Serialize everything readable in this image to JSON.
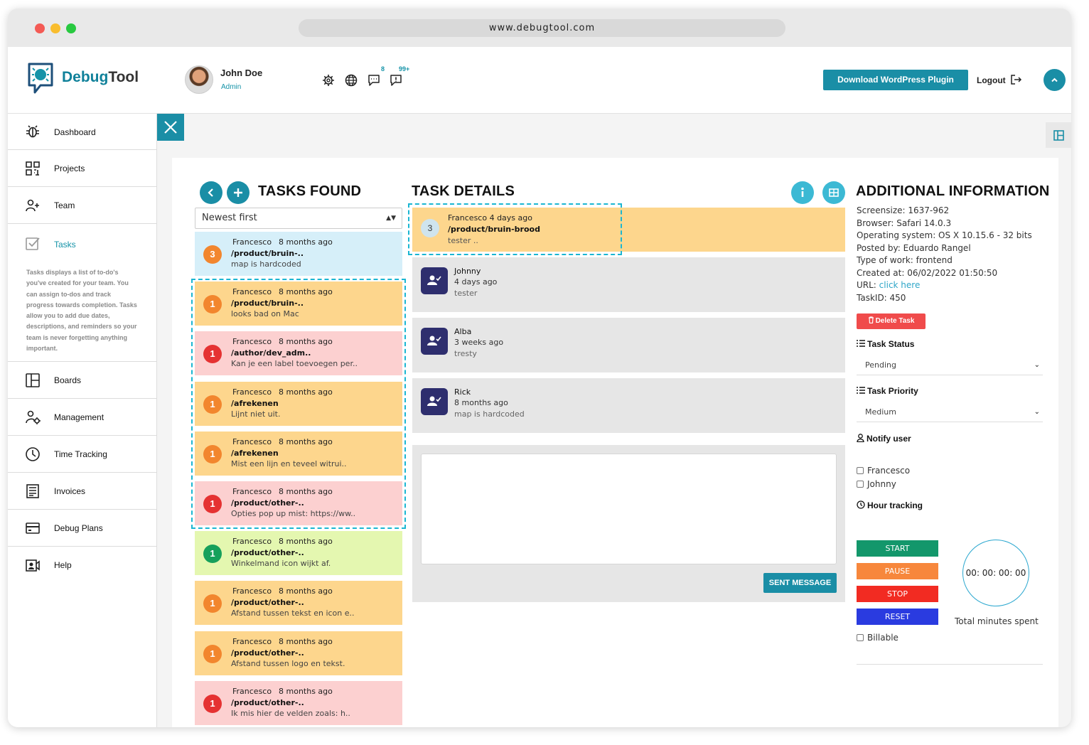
{
  "browser": {
    "url": "www.debugtool.com",
    "traffic_lights": [
      "#f45b55",
      "#f9bd2e",
      "#28c940"
    ]
  },
  "header": {
    "logo_text_1": "Debug",
    "logo_text_2": "Tool",
    "user_name": "John Doe",
    "user_role": "Admin",
    "chat_badge": "8",
    "notify_badge": "99+",
    "download_button": "Download WordPress Plugin",
    "logout": "Logout"
  },
  "sidebar": {
    "items": [
      {
        "label": "Dashboard",
        "icon": "bug-icon"
      },
      {
        "label": "Projects",
        "icon": "grid-icon"
      },
      {
        "label": "Team",
        "icon": "team-icon"
      },
      {
        "label": "Tasks",
        "icon": "checkbox-icon"
      },
      {
        "label": "Boards",
        "icon": "board-icon"
      },
      {
        "label": "Management",
        "icon": "management-icon"
      },
      {
        "label": "Time Tracking",
        "icon": "clock-icon"
      },
      {
        "label": "Invoices",
        "icon": "invoice-icon"
      },
      {
        "label": "Debug Plans",
        "icon": "card-icon"
      },
      {
        "label": "Help",
        "icon": "help-icon"
      }
    ],
    "tasks_description": "Tasks displays a list of to-do's you've created for your team. You can assign to-dos and track progress towards completion. Tasks allow you to add due dates, descriptions, and reminders so your team is never forgetting anything important."
  },
  "tasks": {
    "title": "TASKS FOUND",
    "sort_value": "Newest first",
    "items": [
      {
        "count": "3",
        "author": "Francesco",
        "time": "8 months ago",
        "path": "/product/bruin-..",
        "message": "map is hardcoded",
        "bg": "#d6eff9",
        "badge": "#f2862e"
      },
      {
        "count": "1",
        "author": "Francesco",
        "time": "8 months ago",
        "path": "/product/bruin-..",
        "message": "looks bad on Mac",
        "bg": "#fdd68d",
        "badge": "#f2862e"
      },
      {
        "count": "1",
        "author": "Francesco",
        "time": "8 months ago",
        "path": "/author/dev_adm..",
        "message": "Kan je een label toevoegen per..",
        "bg": "#fcd0d0",
        "badge": "#e53232"
      },
      {
        "count": "1",
        "author": "Francesco",
        "time": "8 months ago",
        "path": "/afrekenen",
        "message": "Lijnt niet uit.",
        "bg": "#fdd68d",
        "badge": "#f2862e"
      },
      {
        "count": "1",
        "author": "Francesco",
        "time": "8 months ago",
        "path": "/afrekenen",
        "message": "Mist een lijn en teveel witrui..",
        "bg": "#fdd68d",
        "badge": "#f2862e"
      },
      {
        "count": "1",
        "author": "Francesco",
        "time": "8 months ago",
        "path": "/product/other-..",
        "message": "Opties pop up mist: https://ww..",
        "bg": "#fcd0d0",
        "badge": "#e53232"
      },
      {
        "count": "1",
        "author": "Francesco",
        "time": "8 months ago",
        "path": "/product/other-..",
        "message": "Winkelmand icon wijkt af.",
        "bg": "#e4f7b0",
        "badge": "#16a05b"
      },
      {
        "count": "1",
        "author": "Francesco",
        "time": "8 months ago",
        "path": "/product/other-..",
        "message": "Afstand tussen tekst en icon e..",
        "bg": "#fdd68d",
        "badge": "#f2862e"
      },
      {
        "count": "1",
        "author": "Francesco",
        "time": "8 months ago",
        "path": "/product/other-..",
        "message": "Afstand tussen logo en tekst.",
        "bg": "#fdd68d",
        "badge": "#f2862e"
      },
      {
        "count": "1",
        "author": "Francesco",
        "time": "8 months ago",
        "path": "/product/other-..",
        "message": "Ik mis hier de velden zoals: h..",
        "bg": "#fcd0d0",
        "badge": "#e53232"
      }
    ]
  },
  "details": {
    "title": "TASK DETAILS",
    "selected": {
      "count": "3",
      "line1": "Francesco 4 days ago",
      "path": "/product/bruin-brood",
      "message": "tester .."
    },
    "comments": [
      {
        "name": "Johnny",
        "time": "4 days ago",
        "message": "tester"
      },
      {
        "name": "Alba",
        "time": "3 weeks ago",
        "message": "tresty"
      },
      {
        "name": "Rick",
        "time": "8 months ago",
        "message": "map is hardcoded"
      }
    ],
    "send_button": "SENT MESSAGE"
  },
  "additional": {
    "title": "ADDITIONAL INFORMATION",
    "screensize": "Screensize: 1637-962",
    "browser": "Browser: Safari 14.0.3",
    "os": "Operating system: OS X 10.15.6 - 32 bits",
    "posted_by": "Posted by: Eduardo Rangel",
    "type_of_work": "Type of work: frontend",
    "created_at": "Created at: 06/02/2022 01:50:50",
    "url_label": "URL: ",
    "url_link": "click here",
    "task_id": "TaskID: 450",
    "delete_button": "Delete Task",
    "status_label": "Task Status",
    "status_value": "Pending",
    "priority_label": "Task Priority",
    "priority_value": "Medium",
    "notify_label": "Notify user",
    "notify_users": [
      "Francesco",
      "Johnny"
    ],
    "hour_label": "Hour tracking",
    "start": "START",
    "pause": "PAUSE",
    "stop": "STOP",
    "reset": "RESET",
    "timer": "00: 00: 00: 00",
    "total_label": "Total minutes spent",
    "billable": "Billable"
  },
  "colors": {
    "accent": "#1a8ea6",
    "start": "#13976b",
    "pause": "#f7873c",
    "stop": "#f22b22",
    "reset": "#2a3be0"
  }
}
